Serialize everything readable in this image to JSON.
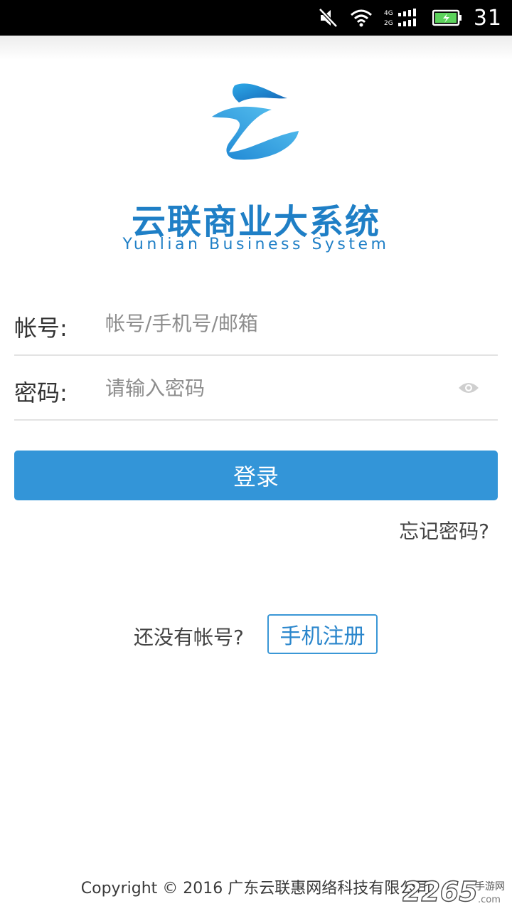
{
  "status_bar": {
    "network_labels": [
      "4G",
      "2G"
    ],
    "time": "31",
    "icons": [
      "mute-icon",
      "wifi-icon",
      "signal-icon",
      "battery-icon"
    ]
  },
  "brand": {
    "name_cn": "云联商业大系统",
    "name_en": "Yunlian  Business  System",
    "color": "#1f7fc6"
  },
  "form": {
    "account": {
      "label": "帐号:",
      "placeholder": "帐号/手机号/邮箱",
      "value": ""
    },
    "password": {
      "label": "密码:",
      "placeholder": "请输入密码",
      "value": "",
      "toggle_icon": "eye-icon"
    },
    "login_label": "登录",
    "forgot_label": "忘记密码?"
  },
  "register": {
    "prompt": "还没有帐号?",
    "button_label": "手机注册"
  },
  "footer": {
    "copyright": "Copyright © 2016 广东云联惠网络科技有限公司"
  },
  "watermark": {
    "number": "2265",
    "suffix": "手游网",
    "domain": ".com"
  },
  "colors": {
    "primary": "#3395d8",
    "outline": "#3a97d6",
    "divider": "#e3e3e3"
  }
}
